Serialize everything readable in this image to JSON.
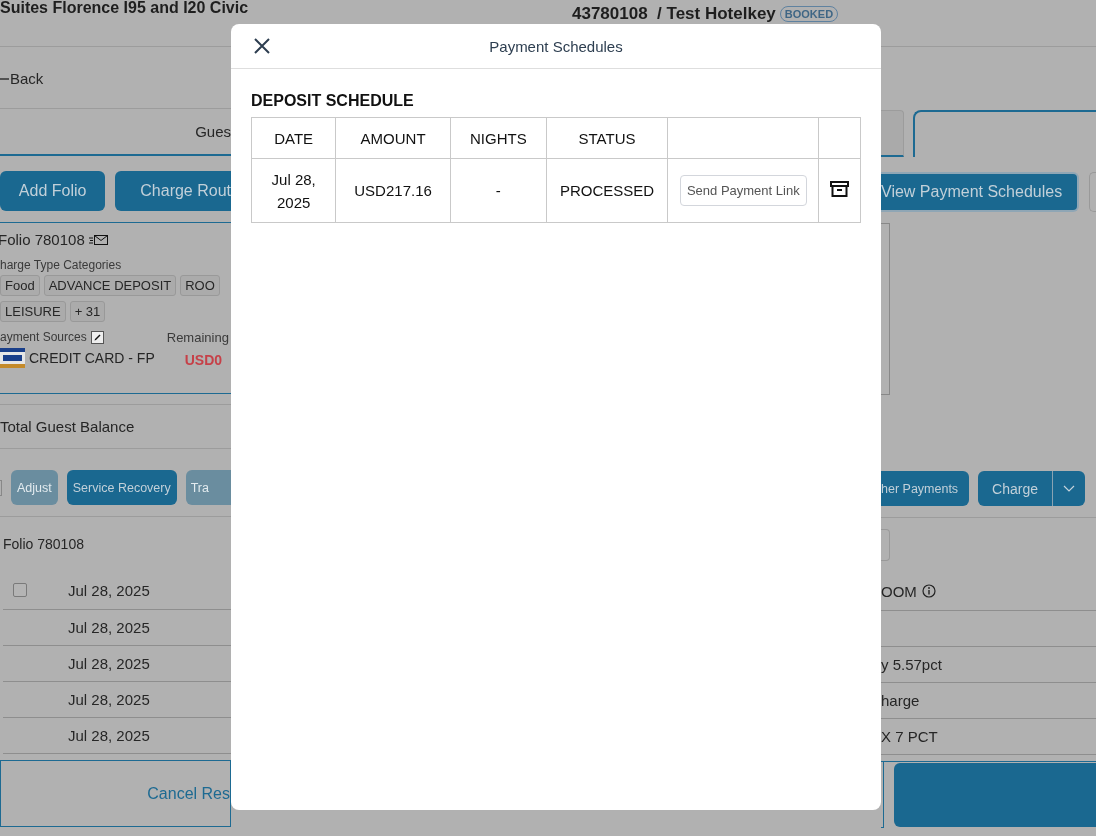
{
  "header": {
    "hotel_name": "Suites Florence I95 and I20 Civic",
    "reservation": "43780108  / Test Hotelkey",
    "status_badge": "BOOKED"
  },
  "back_link": "Back",
  "tabs": [
    {
      "label": "Gues",
      "selected": false
    },
    {
      "selected": true
    }
  ],
  "folio_actions": [
    "Add Folio",
    "Charge Rout",
    "View Payment Schedules"
  ],
  "folio_card": {
    "title": "Folio 780108",
    "categories_label": "harge Type Categories",
    "categories": [
      "Food",
      "ADVANCE DEPOSIT",
      "ROO",
      "LEISURE",
      "+ 31"
    ],
    "payment_sources_label": "ayment Sources",
    "remaining_label": "Remaining",
    "payment_source": "CREDIT CARD - FP",
    "remaining_amount": "USD0"
  },
  "total_guest_balance_label": "Total Guest Balance",
  "transaction_actions": [
    {
      "label": "Adjust",
      "disabled": true
    },
    {
      "label": "Service Recovery",
      "disabled": false
    },
    {
      "label": "Tra",
      "disabled": true
    },
    {
      "label": "her Payments",
      "disabled": false
    },
    {
      "label": "Charge",
      "disabled": false
    }
  ],
  "transactions": {
    "folio_label": "Folio 780108",
    "rows": [
      {
        "kind": "selectable",
        "checked": false,
        "date": "Jul 28, 2025",
        "description": "OOM",
        "info": true
      },
      {
        "kind": "plain",
        "date": "Jul 28, 2025"
      },
      {
        "kind": "plain",
        "date": "Jul 28, 2025",
        "description": "y 5.57pct"
      },
      {
        "kind": "plain",
        "date": "Jul 28, 2025",
        "description": "harge"
      },
      {
        "kind": "plain",
        "date": "Jul 28, 2025",
        "description": "X 7 PCT"
      }
    ]
  },
  "footer_buttons": [
    {
      "kind": "outline",
      "label": "Cancel Res"
    },
    {
      "kind": "primary"
    }
  ],
  "modal": {
    "title": "Payment Schedules",
    "section_title": "DEPOSIT SCHEDULE",
    "columns": [
      "DATE",
      "AMOUNT",
      "NIGHTS",
      "STATUS"
    ],
    "rows": [
      {
        "date": "Jul 28, 2025",
        "amount": "USD217.16",
        "nights": "-",
        "status": "PROCESSED",
        "action": "Send Payment Link"
      }
    ]
  }
}
